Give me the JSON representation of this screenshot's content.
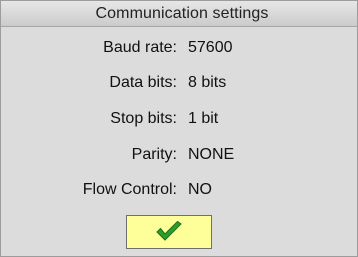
{
  "dialog": {
    "title": "Communication settings",
    "fields": [
      {
        "label": "Baud rate:",
        "value": "57600"
      },
      {
        "label": "Data bits:",
        "value": "8 bits"
      },
      {
        "label": "Stop bits:",
        "value": "1 bit"
      },
      {
        "label": "Parity:",
        "value": "NONE"
      },
      {
        "label": "Flow Control:",
        "value": "NO"
      }
    ],
    "ok_button": {
      "icon": "checkmark-icon",
      "background_color": "#ffff99",
      "icon_color": "#2e9e2a"
    }
  }
}
